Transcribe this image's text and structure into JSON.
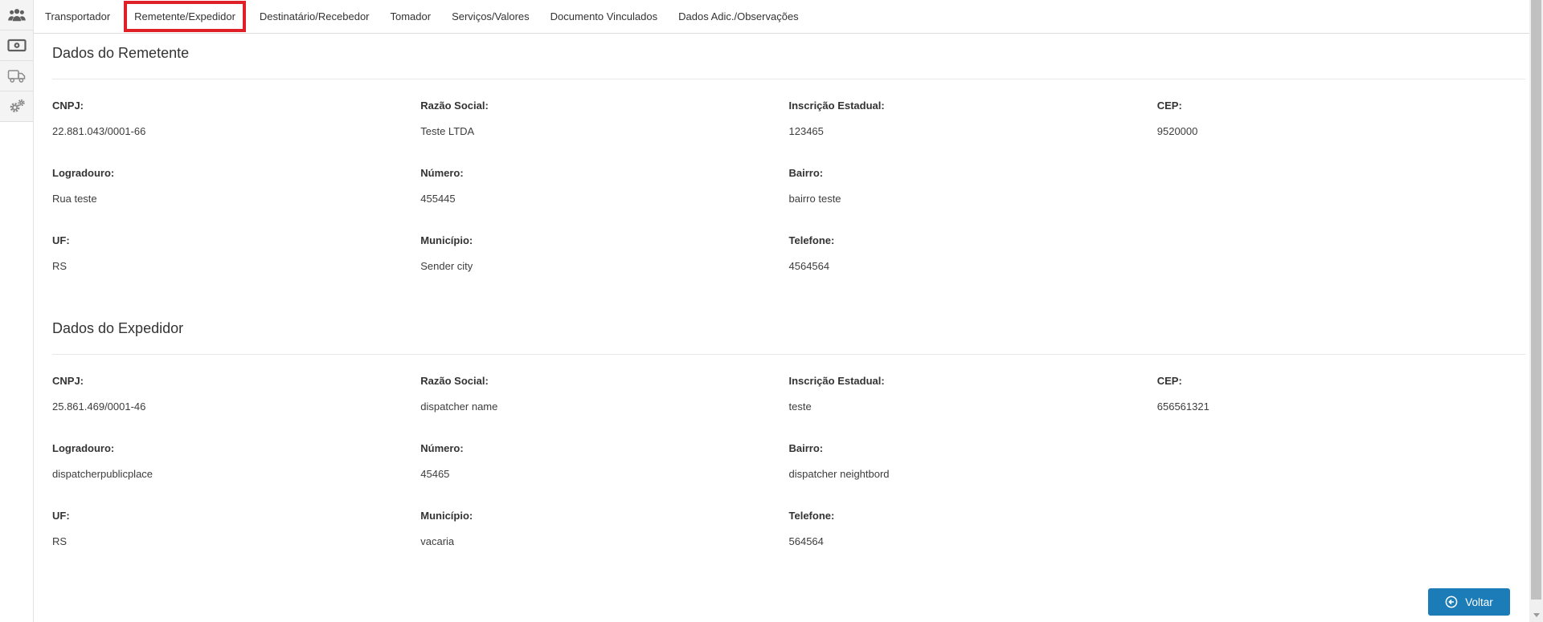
{
  "sidebar": {
    "items": [
      {
        "icon": "users-icon"
      },
      {
        "icon": "money-icon"
      },
      {
        "icon": "truck-icon"
      },
      {
        "icon": "gears-icon"
      }
    ]
  },
  "tabs": {
    "items": [
      {
        "label": "Transportador",
        "highlighted": false
      },
      {
        "label": "Remetente/Expedidor",
        "highlighted": true
      },
      {
        "label": "Destinatário/Recebedor",
        "highlighted": false
      },
      {
        "label": "Tomador",
        "highlighted": false
      },
      {
        "label": "Serviços/Valores",
        "highlighted": false
      },
      {
        "label": "Documento Vinculados",
        "highlighted": false
      },
      {
        "label": "Dados Adic./Observações",
        "highlighted": false
      }
    ]
  },
  "sections": [
    {
      "title": "Dados do Remetente",
      "rows": [
        [
          {
            "label": "CNPJ:",
            "value": "22.881.043/0001-66"
          },
          {
            "label": "Razão Social:",
            "value": "Teste LTDA"
          },
          {
            "label": "Inscrição Estadual:",
            "value": "123465"
          },
          {
            "label": "CEP:",
            "value": "9520000"
          }
        ],
        [
          {
            "label": "Logradouro:",
            "value": "Rua teste"
          },
          {
            "label": "Número:",
            "value": "455445"
          },
          {
            "label": "Bairro:",
            "value": "bairro teste"
          }
        ],
        [
          {
            "label": "UF:",
            "value": "RS"
          },
          {
            "label": "Município:",
            "value": "Sender city"
          },
          {
            "label": "Telefone:",
            "value": "4564564"
          }
        ]
      ]
    },
    {
      "title": "Dados do Expedidor",
      "rows": [
        [
          {
            "label": "CNPJ:",
            "value": "25.861.469/0001-46"
          },
          {
            "label": "Razão Social:",
            "value": "dispatcher name"
          },
          {
            "label": "Inscrição Estadual:",
            "value": "teste"
          },
          {
            "label": "CEP:",
            "value": "656561321"
          }
        ],
        [
          {
            "label": "Logradouro:",
            "value": "dispatcherpublicplace"
          },
          {
            "label": "Número:",
            "value": "45465"
          },
          {
            "label": "Bairro:",
            "value": "dispatcher neightbord"
          }
        ],
        [
          {
            "label": "UF:",
            "value": "RS"
          },
          {
            "label": "Município:",
            "value": "vacaria"
          },
          {
            "label": "Telefone:",
            "value": "564564"
          }
        ]
      ]
    }
  ],
  "footer": {
    "back_button": {
      "label": "Voltar",
      "icon": "circle-arrow-left-icon"
    }
  },
  "colors": {
    "back_button_blue": "#1c7cb8",
    "tab_highlight_red": "#df2027",
    "icon_gray": "#5f5f5f",
    "icon_light_gray": "#8a8a8a"
  }
}
